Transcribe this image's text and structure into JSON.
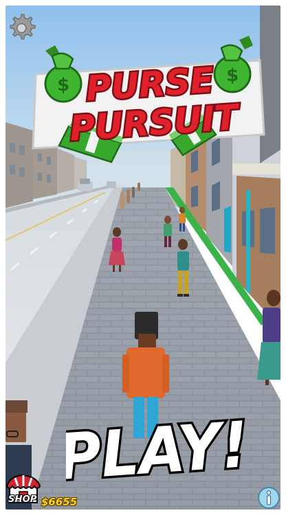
{
  "title": {
    "line1": "PURSE",
    "line2": "PURSUIT"
  },
  "play_label": "PLAY!",
  "shop": {
    "label": "SHOP"
  },
  "currency": {
    "amount": "$6655"
  },
  "icons": {
    "settings": "gear-icon",
    "info": "info-icon",
    "shop": "shop-awning-icon",
    "money_bag": "money-bag-icon",
    "cash": "cash-stack-icon"
  },
  "colors": {
    "sky": "#a9cfee",
    "title_red": "#e0202a",
    "title_outline": "#7a0f16",
    "money_green": "#3fb531",
    "money_gold": "#ffd21a",
    "play_text": "#ffffff"
  }
}
